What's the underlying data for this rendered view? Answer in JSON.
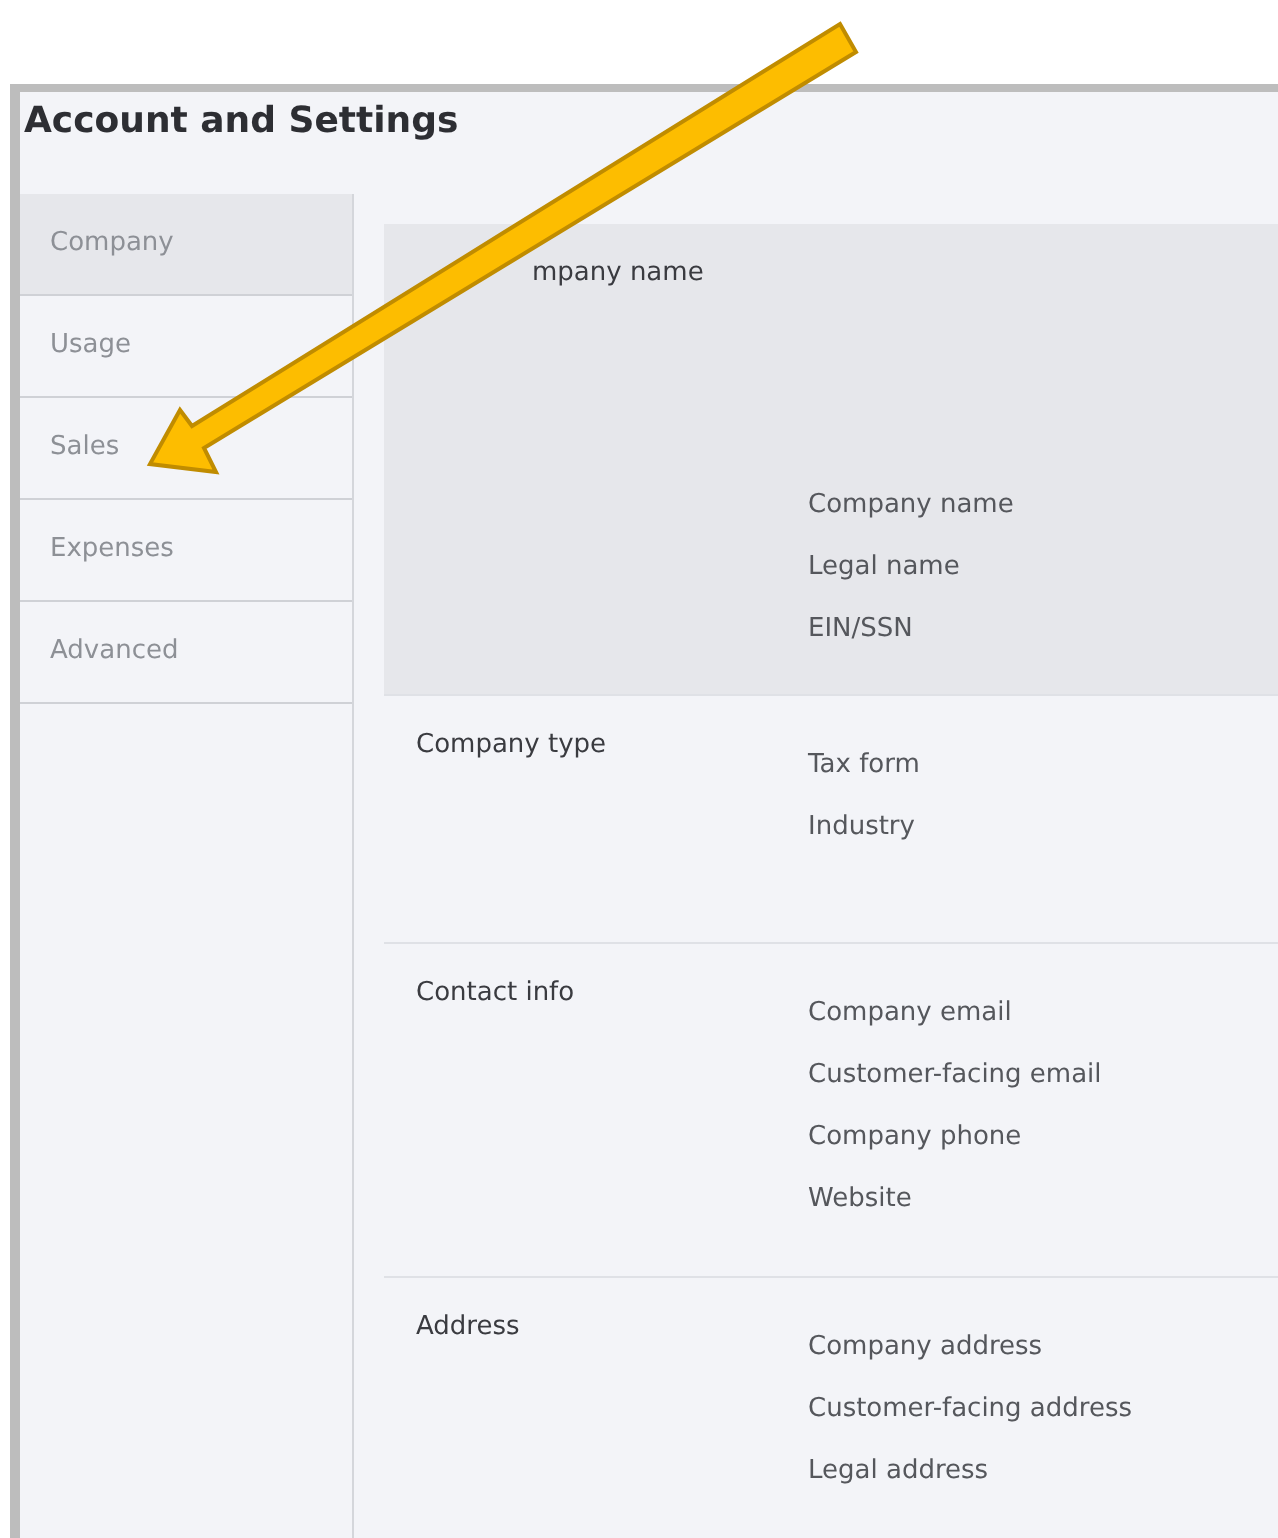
{
  "window": {
    "title": "Account and Settings"
  },
  "sidebar": {
    "items": [
      {
        "label": "Company",
        "selected": true
      },
      {
        "label": "Usage",
        "selected": false
      },
      {
        "label": "Sales",
        "selected": false
      },
      {
        "label": "Expenses",
        "selected": false
      },
      {
        "label": "Advanced",
        "selected": false
      }
    ]
  },
  "sections": [
    {
      "title": "mpany name",
      "selected": true,
      "fields": [
        "Company name",
        "Legal name",
        "EIN/SSN"
      ]
    },
    {
      "title": "Company type",
      "selected": false,
      "fields": [
        "Tax form",
        "Industry"
      ]
    },
    {
      "title": "Contact info",
      "selected": false,
      "fields": [
        "Company email",
        "Customer-facing email",
        "Company phone",
        "Website"
      ]
    },
    {
      "title": "Address",
      "selected": false,
      "fields": [
        "Company address",
        "Customer-facing address",
        "Legal address"
      ]
    }
  ]
}
